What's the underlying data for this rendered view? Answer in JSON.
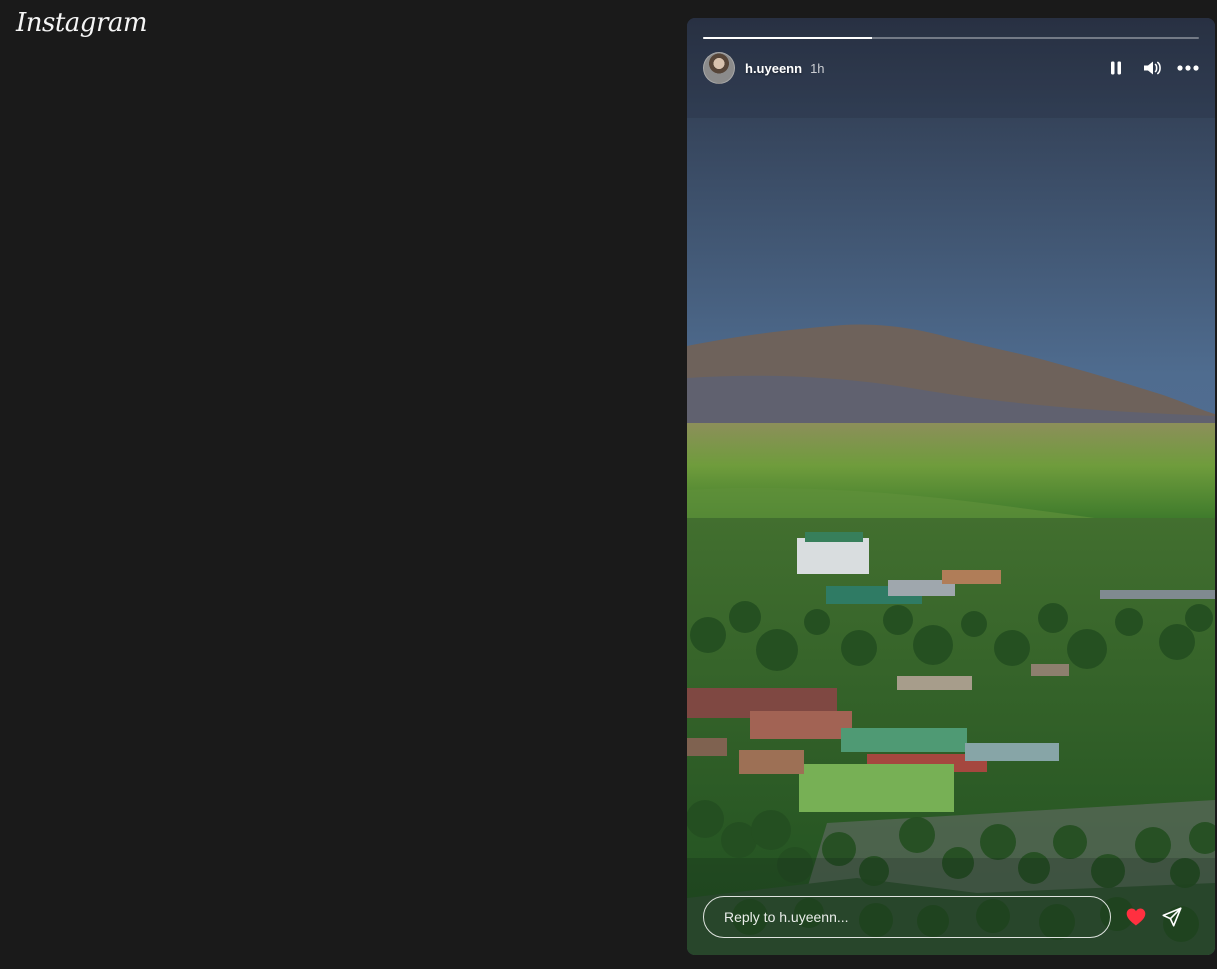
{
  "app": {
    "logo_text": "Instagram"
  },
  "story": {
    "username": "h.uyeenn",
    "time_ago": "1h",
    "progress": 0.34,
    "reply_placeholder": "Reply to h.uyeenn...",
    "icons": {
      "pause": "pause-icon",
      "volume": "volume-icon",
      "more": "more-options-icon",
      "like": "heart-icon",
      "share": "send-icon"
    },
    "colors": {
      "like": "#ff3040",
      "background": "#1a1a1a"
    }
  }
}
